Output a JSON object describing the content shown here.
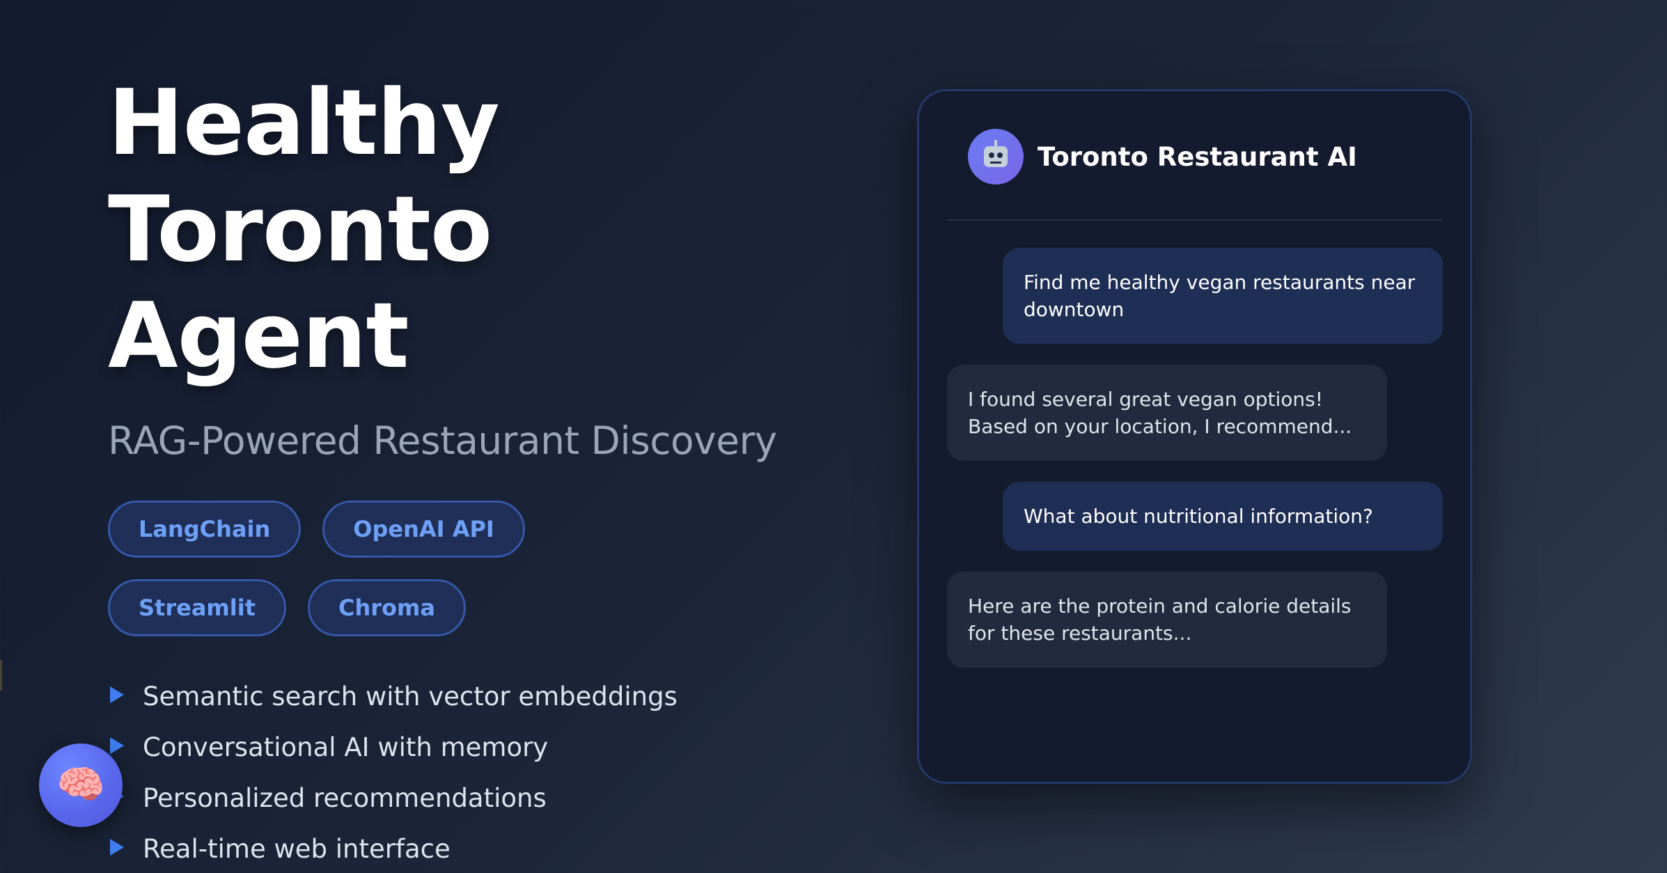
{
  "hero": {
    "title_line1": "Healthy",
    "title_line2": "Toronto Agent",
    "subtitle": "RAG-Powered Restaurant Discovery"
  },
  "tags": [
    "LangChain",
    "OpenAI API",
    "Streamlit",
    "Chroma"
  ],
  "features": [
    "Semantic search with vector embeddings",
    "Conversational AI with memory",
    "Personalized recommendations",
    "Real-time web interface"
  ],
  "chat": {
    "title": "Toronto Restaurant AI",
    "avatar_icon": "robot-icon",
    "messages": [
      {
        "role": "user",
        "text": "Find me healthy vegan restaurants near downtown"
      },
      {
        "role": "ai",
        "text": "I found several great vegan options! Based on your location, I recommend..."
      },
      {
        "role": "user",
        "text": "What about nutritional information?"
      },
      {
        "role": "ai",
        "text": "Here are the protein and calorie details for these restaurants..."
      }
    ]
  },
  "floating_button": {
    "icon": "brain-icon",
    "glyph": "🧠"
  },
  "colors": {
    "accent": "#3f7df0",
    "tag_text": "#6ea0f7",
    "tag_border": "#3558a8",
    "tag_bg": "#1f2f57",
    "user_bubble": "#1f2e54",
    "ai_bubble": "#222b3d",
    "panel_bg": "#141b2e"
  }
}
